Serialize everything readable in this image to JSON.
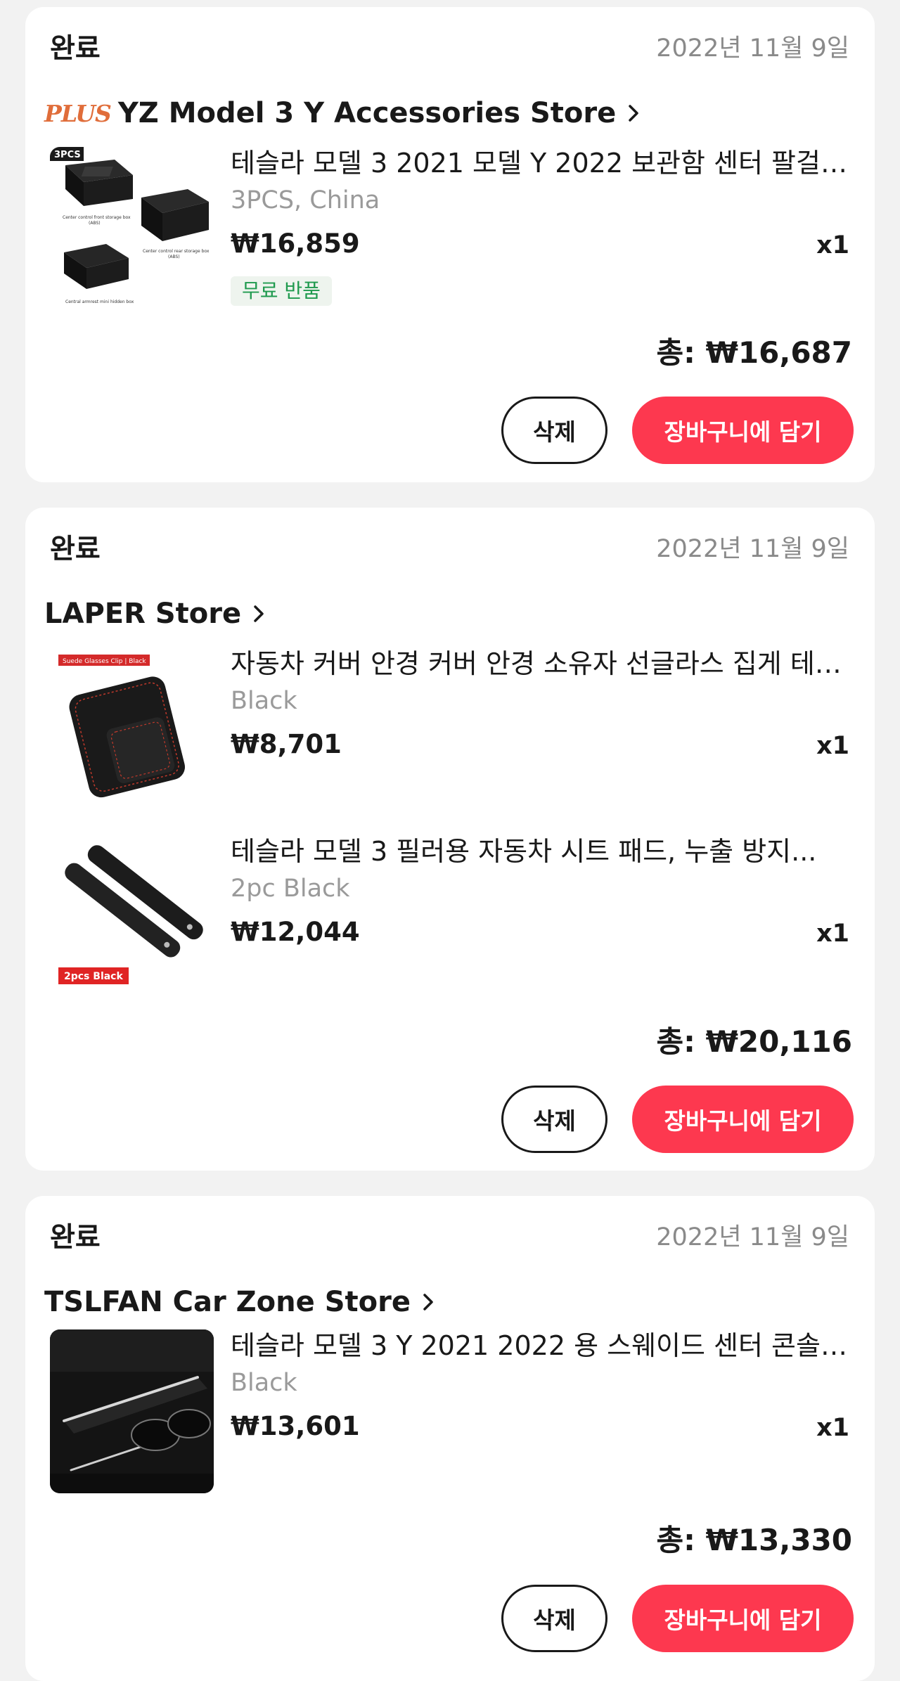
{
  "orders": [
    {
      "status": "완료",
      "date": "2022년 11월 9일",
      "store_badge": "PLUS",
      "store_name": "YZ Model 3 Y Accessories Store",
      "items": [
        {
          "title": "테슬라 모델 3 2021 모델 Y 2022 보관함 센터 팔걸이 수납 정리함",
          "sku": "3PCS, China",
          "price": "₩16,859",
          "qty": "x1",
          "badge": "무료 반품",
          "thumb_text": {
            "tag": "3PCS",
            "label_1": "Center control front storage box",
            "label_1b": "(ABS)",
            "label_2": "Center control rear storage box",
            "label_2b": "(ABS)",
            "label_3": "Central armrest mini hidden box"
          }
        }
      ],
      "total": "총: ₩16,687",
      "delete_label": "삭제",
      "cart_label": "장바구니에 담기"
    },
    {
      "status": "완료",
      "date": "2022년 11월 9일",
      "store_name": "LAPER Store",
      "items": [
        {
          "title": "자동차 커버 안경 커버 안경 소유자 선글라스 집게 테슬라 모델",
          "sku": "Black",
          "price": "₩8,701",
          "qty": "x1",
          "thumb_text": {
            "tag": "Suede Glasses Clip | Black"
          }
        },
        {
          "title": "테슬라 모델 3 필러용 자동차 시트 패드, 누출 방지...",
          "sku": "2pc Black",
          "price": "₩12,044",
          "qty": "x1",
          "thumb_text": {
            "tag": "2pcs Black"
          }
        }
      ],
      "total": "총: ₩20,116",
      "delete_label": "삭제",
      "cart_label": "장바구니에 담기"
    },
    {
      "status": "완료",
      "date": "2022년 11월 9일",
      "store_name": "TSLFAN Car Zone Store",
      "items": [
        {
          "title": "테슬라 모델 3 Y 2021 2022 용 스웨이드 센터 콘솔 커버 트림",
          "sku": "Black",
          "price": "₩13,601",
          "qty": "x1"
        }
      ],
      "total": "총: ₩13,330",
      "delete_label": "삭제",
      "cart_label": "장바구니에 담기"
    }
  ],
  "colors": {
    "accent": "#fd384f",
    "free_return_green": "#1f9a4e",
    "plus_orange": "#e06d3a",
    "background": "#f2f2f2"
  },
  "icons": {
    "store_link": "chevron-right-icon"
  }
}
